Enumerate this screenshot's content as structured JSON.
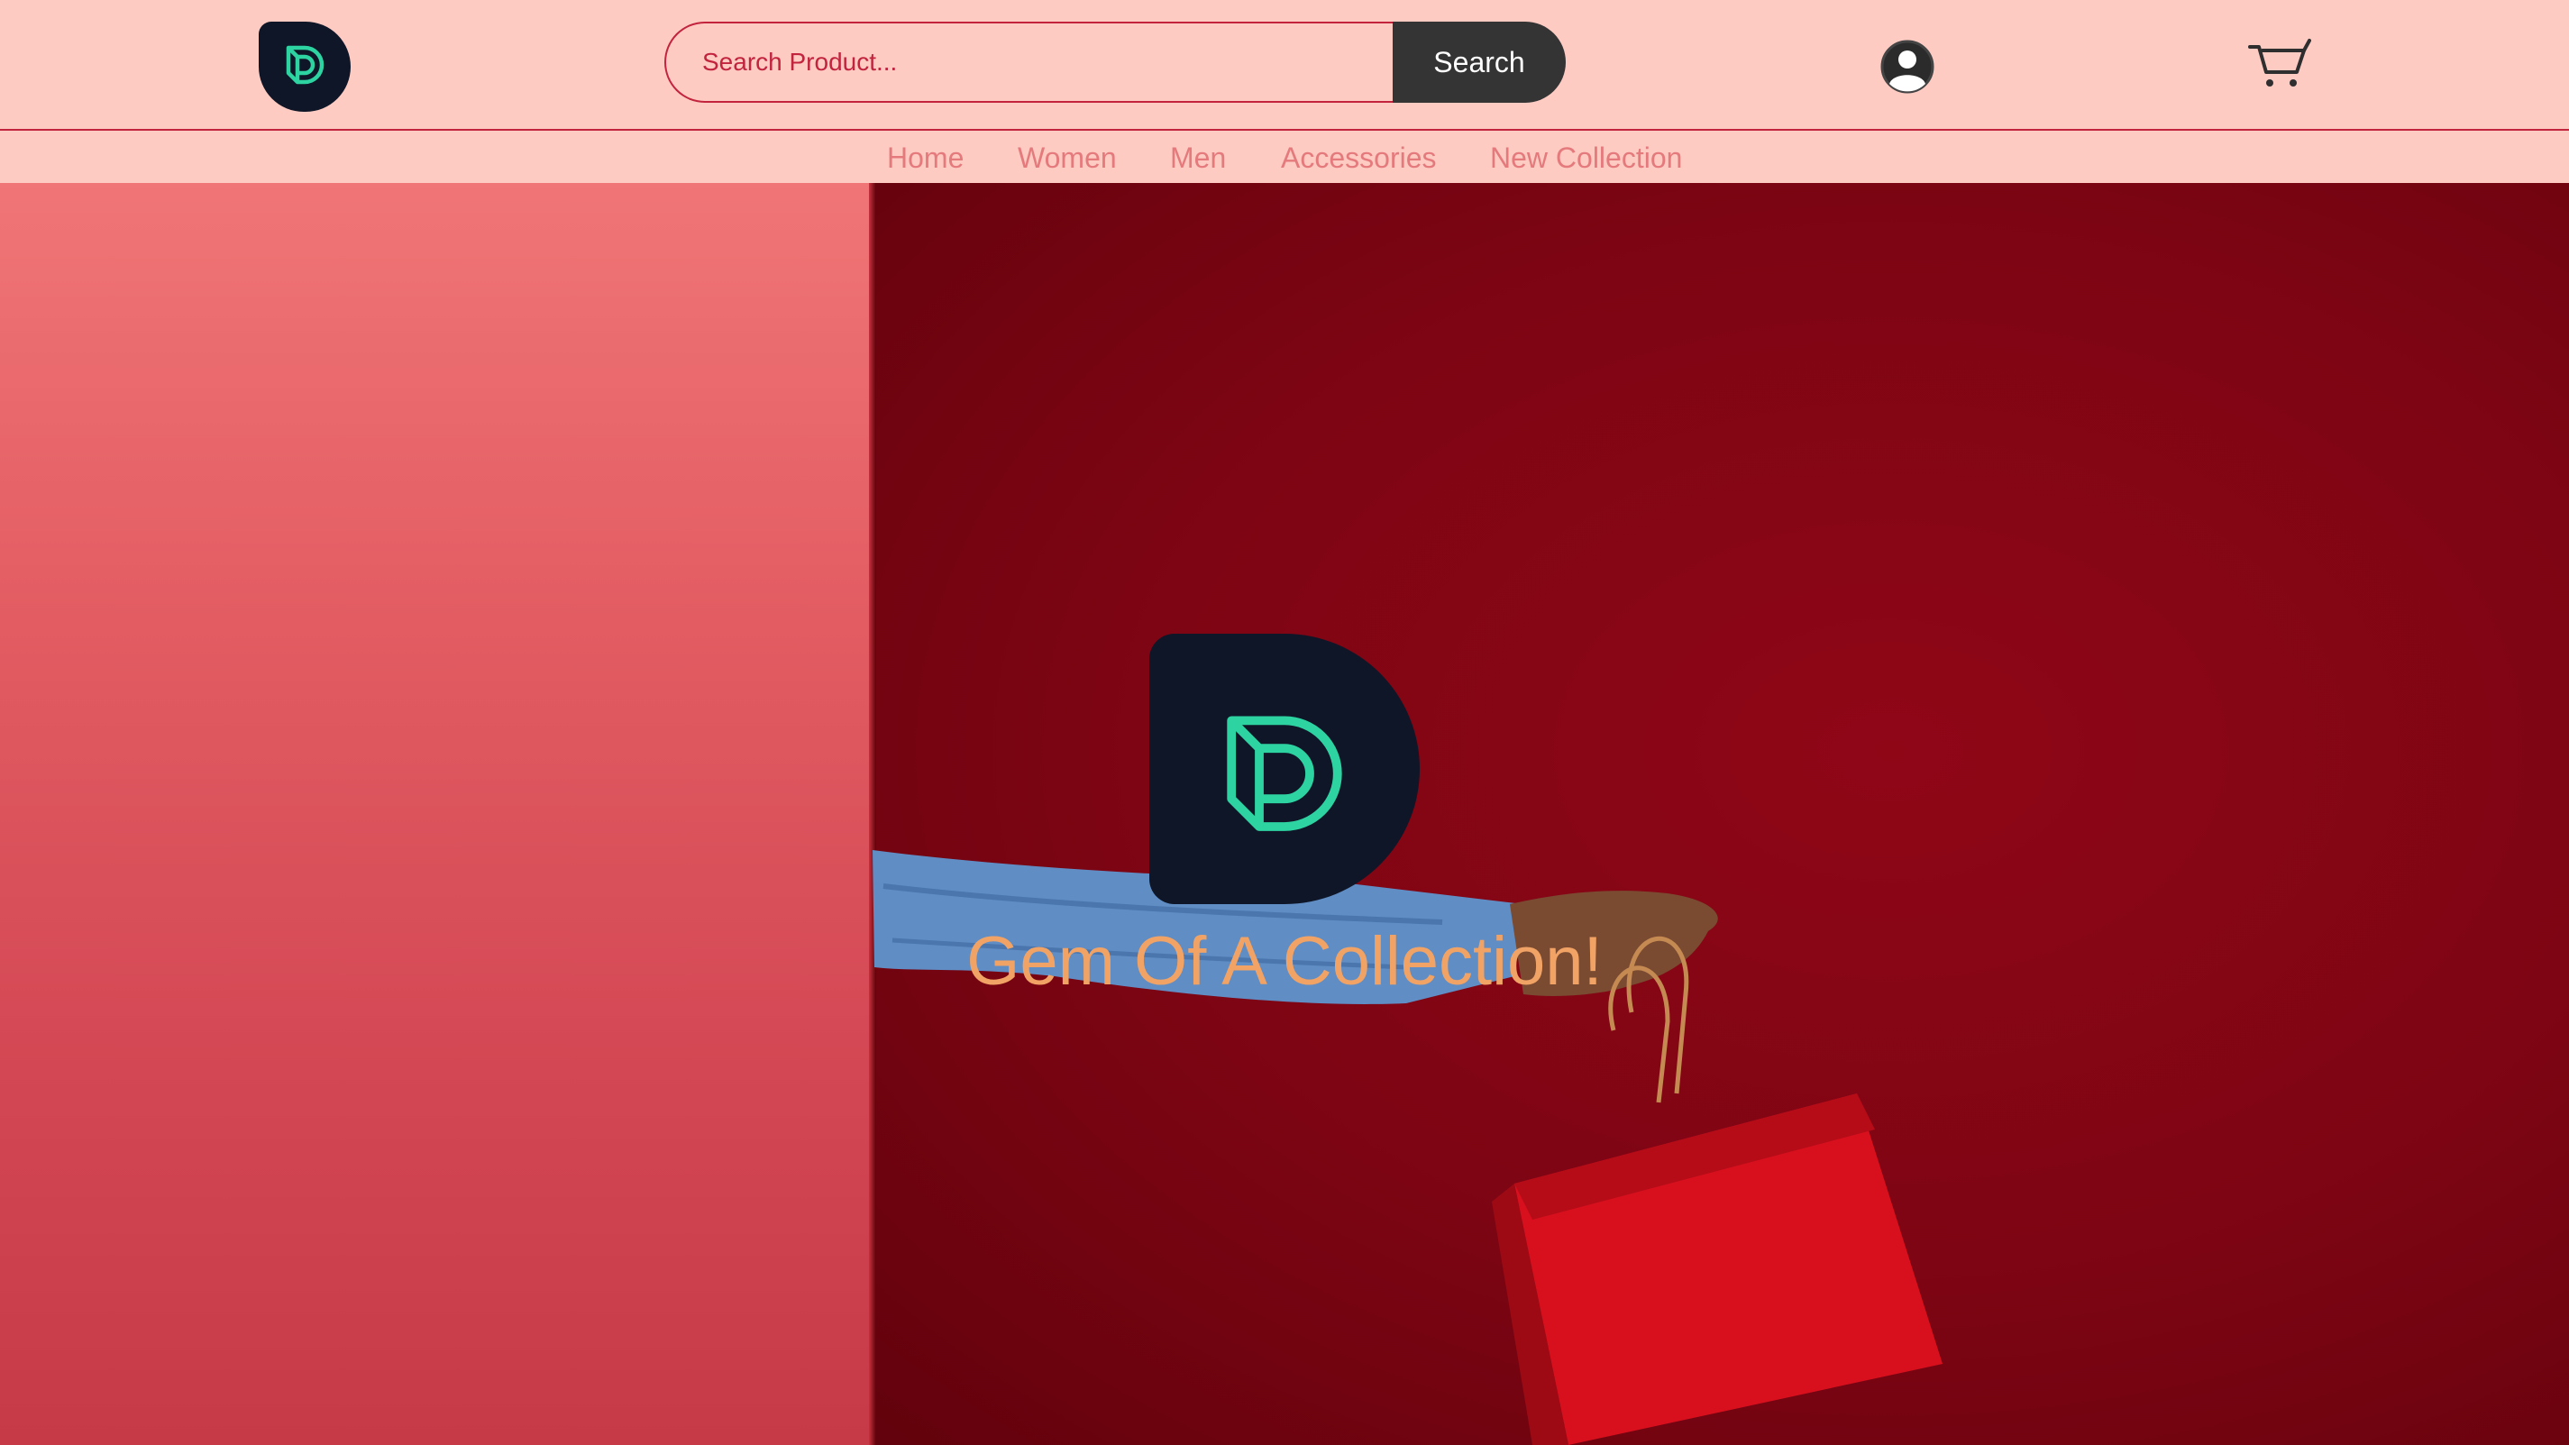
{
  "header": {
    "logo": {
      "icon": "d-monogram-logo",
      "colors": {
        "bg": "#0e1627",
        "mark": "#2ed3a2"
      }
    },
    "search": {
      "placeholder": "Search Product...",
      "button_label": "Search"
    },
    "user_icon": "user-icon",
    "cart_icon": "cart-icon"
  },
  "nav": {
    "items": [
      {
        "label": "Home"
      },
      {
        "label": "Women"
      },
      {
        "label": "Men"
      },
      {
        "label": "Accessories"
      },
      {
        "label": "New Collection"
      }
    ]
  },
  "hero": {
    "tagline": "Gem Of A Collection!",
    "logo_icon": "d-monogram-logo"
  },
  "colors": {
    "header_bg": "#fecbc3",
    "accent": "#c2233d",
    "nav_text": "#e57a7d",
    "search_button": "#343434",
    "tagline": "#f1a366",
    "logo_green": "#2ed3a2"
  }
}
